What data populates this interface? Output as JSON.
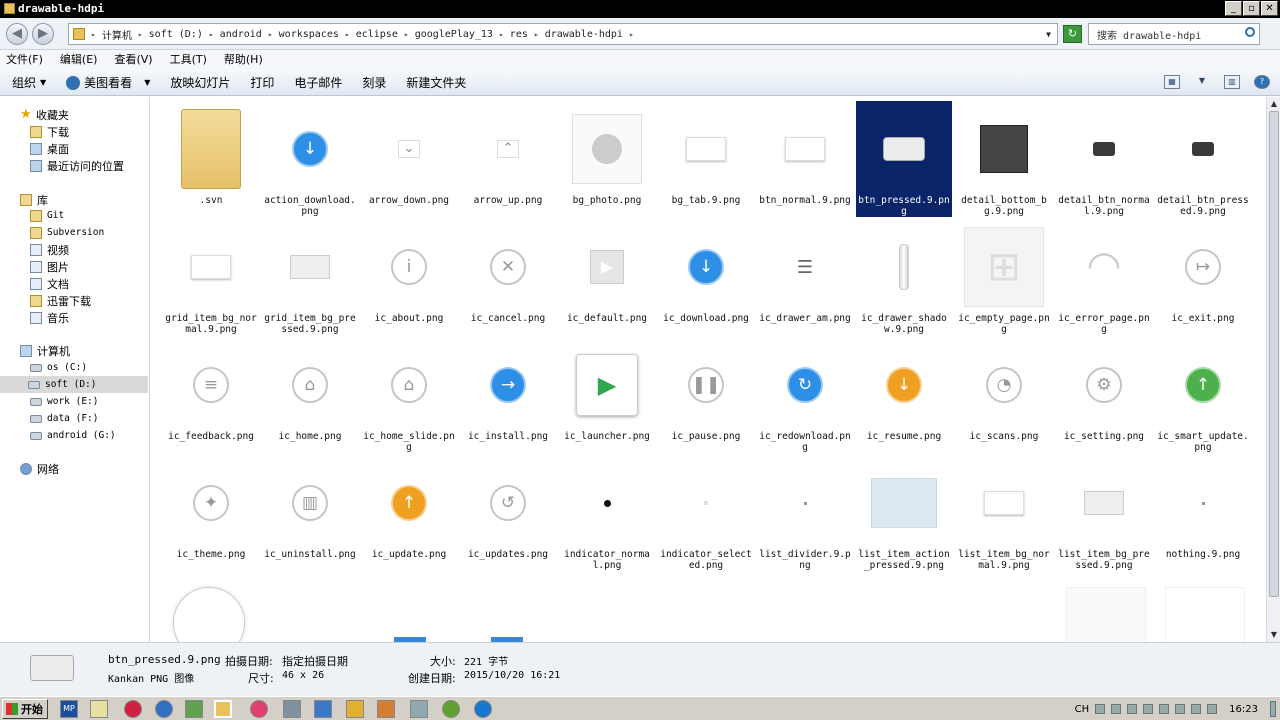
{
  "window": {
    "title": "drawable-hdpi"
  },
  "address": {
    "crumbs": [
      "计算机",
      "soft (D:)",
      "android",
      "workspaces",
      "eclipse",
      "googlePlay_13",
      "res",
      "drawable-hdpi"
    ],
    "search_placeholder": "搜索 drawable-hdpi"
  },
  "menu": [
    "文件(F)",
    "编辑(E)",
    "查看(V)",
    "工具(T)",
    "帮助(H)"
  ],
  "toolbar": {
    "organize": "组织",
    "meitu": "美图看看",
    "slideshow": "放映幻灯片",
    "print": "打印",
    "email": "电子邮件",
    "burn": "刻录",
    "new_folder": "新建文件夹"
  },
  "nav": {
    "favorites": "收藏夹",
    "fav_items": [
      "下载",
      "桌面",
      "最近访问的位置"
    ],
    "libraries": "库",
    "lib_items": [
      "Git",
      "Subversion",
      "视频",
      "图片",
      "文档",
      "迅雷下载",
      "音乐"
    ],
    "computer": "计算机",
    "drives": [
      "os (C:)",
      "soft (D:)",
      "work (E:)",
      "data (F:)",
      "android (G:)"
    ],
    "network": "网络"
  },
  "files": [
    {
      "name": ".svn",
      "icon": "folder-icon"
    },
    {
      "name": "action_download.png",
      "icon": "download-circle-icon"
    },
    {
      "name": "arrow_down.png",
      "icon": "chevron-down-icon"
    },
    {
      "name": "arrow_up.png",
      "icon": "chevron-up-icon"
    },
    {
      "name": "bg_photo.png",
      "icon": "avatar-icon"
    },
    {
      "name": "bg_tab.9.png",
      "icon": "white-rect"
    },
    {
      "name": "btn_normal.9.png",
      "icon": "white-rect"
    },
    {
      "name": "btn_pressed.9.png",
      "icon": "light-rounded-rect"
    },
    {
      "name": "detail_bottom_bg.9.png",
      "icon": "dark-square"
    },
    {
      "name": "detail_btn_normal.9.png",
      "icon": "dark-small-rect"
    },
    {
      "name": "detail_btn_pressed.9.png",
      "icon": "dark-small-rect"
    },
    {
      "name": "grid_item_bg_normal.9.png",
      "icon": "white-rect"
    },
    {
      "name": "grid_item_bg_pressed.9.png",
      "icon": "light-rect"
    },
    {
      "name": "ic_about.png",
      "icon": "info-icon"
    },
    {
      "name": "ic_cancel.png",
      "icon": "close-icon"
    },
    {
      "name": "ic_default.png",
      "icon": "bag-icon"
    },
    {
      "name": "ic_download.png",
      "icon": "download-circle-icon"
    },
    {
      "name": "ic_drawer_am.png",
      "icon": "menu-icon"
    },
    {
      "name": "ic_drawer_shadow.9.png",
      "icon": "shadow-bar"
    },
    {
      "name": "ic_empty_page.png",
      "icon": "empty-bag-icon"
    },
    {
      "name": "ic_error_page.png",
      "icon": "wifi-error-icon"
    },
    {
      "name": "ic_exit.png",
      "icon": "exit-icon"
    },
    {
      "name": "ic_feedback.png",
      "icon": "feedback-icon"
    },
    {
      "name": "ic_home.png",
      "icon": "home-icon"
    },
    {
      "name": "ic_home_slide.png",
      "icon": "home-icon"
    },
    {
      "name": "ic_install.png",
      "icon": "arrow-right-icon"
    },
    {
      "name": "ic_launcher.png",
      "icon": "play-store-icon"
    },
    {
      "name": "ic_pause.png",
      "icon": "pause-icon"
    },
    {
      "name": "ic_redownload.png",
      "icon": "refresh-icon"
    },
    {
      "name": "ic_resume.png",
      "icon": "download-orange-icon"
    },
    {
      "name": "ic_scans.png",
      "icon": "scan-icon"
    },
    {
      "name": "ic_setting.png",
      "icon": "settings-icon"
    },
    {
      "name": "ic_smart_update.png",
      "icon": "upload-green-icon"
    },
    {
      "name": "ic_theme.png",
      "icon": "magic-wand-icon"
    },
    {
      "name": "ic_uninstall.png",
      "icon": "trash-icon"
    },
    {
      "name": "ic_update.png",
      "icon": "upload-orange-icon"
    },
    {
      "name": "ic_updates.png",
      "icon": "updates-icon"
    },
    {
      "name": "indicator_normal.png",
      "icon": "dot-icon"
    },
    {
      "name": "indicator_selected.png",
      "icon": "small-dot-icon"
    },
    {
      "name": "list_divider.9.png",
      "icon": "tiny-dot-icon"
    },
    {
      "name": "list_item_action_pressed.9.png",
      "icon": "lightblue-rect"
    },
    {
      "name": "list_item_bg_normal.9.png",
      "icon": "white-rect"
    },
    {
      "name": "list_item_bg_pressed.9.png",
      "icon": "light-rect"
    },
    {
      "name": "nothing.9.png",
      "icon": "tiny-dot-icon"
    }
  ],
  "selected_file": "btn_pressed.9.png",
  "details": {
    "filename": "btn_pressed.9.png",
    "shoot_date_label": "拍摄日期:",
    "shoot_date_value": "指定拍摄日期",
    "type": "Kankan PNG 图像",
    "size_label": "大小:",
    "size_value": "221 字节",
    "dim_label": "尺寸:",
    "dim_value": "46 x 26",
    "created_label": "创建日期:",
    "created_value": "2015/10/20 16:21"
  },
  "taskbar": {
    "start": "开始",
    "lang": "CH",
    "clock": "16:23"
  }
}
